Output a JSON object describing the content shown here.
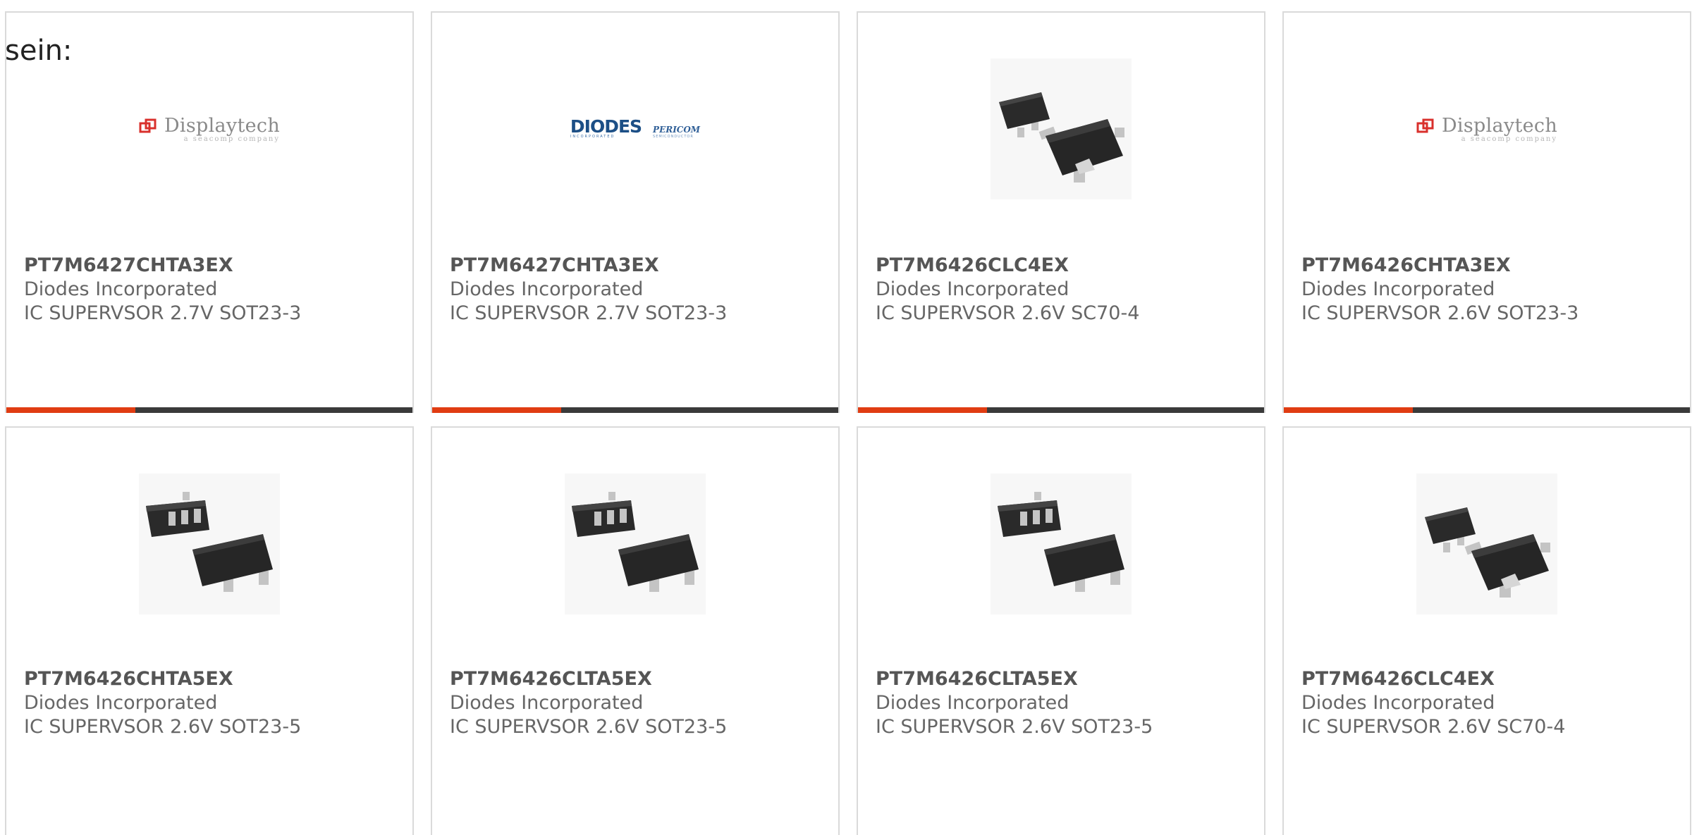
{
  "lead_text": "sein:",
  "colors": {
    "accent": "#e03c12",
    "bar": "#3a3a3a",
    "border": "#dadada"
  },
  "products": [
    {
      "part": "PT7M6427CHTA3EX",
      "manufacturer": "Diodes Incorporated",
      "description": "IC SUPERVSOR 2.7V SOT23-3",
      "image": "displaytech-logo"
    },
    {
      "part": "PT7M6427CHTA3EX",
      "manufacturer": "Diodes Incorporated",
      "description": "IC SUPERVSOR 2.7V SOT23-3",
      "image": "diodes-pericom-logo"
    },
    {
      "part": "PT7M6426CLC4EX",
      "manufacturer": "Diodes Incorporated",
      "description": "IC SUPERVSOR 2.6V SC70-4",
      "image": "sc70-package-photo"
    },
    {
      "part": "PT7M6426CHTA3EX",
      "manufacturer": "Diodes Incorporated",
      "description": "IC SUPERVSOR 2.6V SOT23-3",
      "image": "displaytech-logo"
    },
    {
      "part": "PT7M6426CHTA5EX",
      "manufacturer": "Diodes Incorporated",
      "description": "IC SUPERVSOR 2.6V SOT23-5",
      "image": "sot23-5-package-photo"
    },
    {
      "part": "PT7M6426CLTA5EX",
      "manufacturer": "Diodes Incorporated",
      "description": "IC SUPERVSOR 2.6V SOT23-5",
      "image": "sot23-5-package-photo"
    },
    {
      "part": "PT7M6426CLTA5EX",
      "manufacturer": "Diodes Incorporated",
      "description": "IC SUPERVSOR 2.6V SOT23-5",
      "image": "sot23-5-package-photo"
    },
    {
      "part": "PT7M6426CLC4EX",
      "manufacturer": "Diodes Incorporated",
      "description": "IC SUPERVSOR 2.6V SC70-4",
      "image": "sc70-package-photo"
    }
  ],
  "logos": {
    "displaytech": {
      "name": "Displaytech",
      "tagline": "a seacomp company"
    },
    "diodes": {
      "name": "DIODES",
      "tagline": "INCORPORATED"
    },
    "pericom": {
      "name": "PERICOM",
      "tagline": "SEMICONDUCTOR"
    }
  }
}
